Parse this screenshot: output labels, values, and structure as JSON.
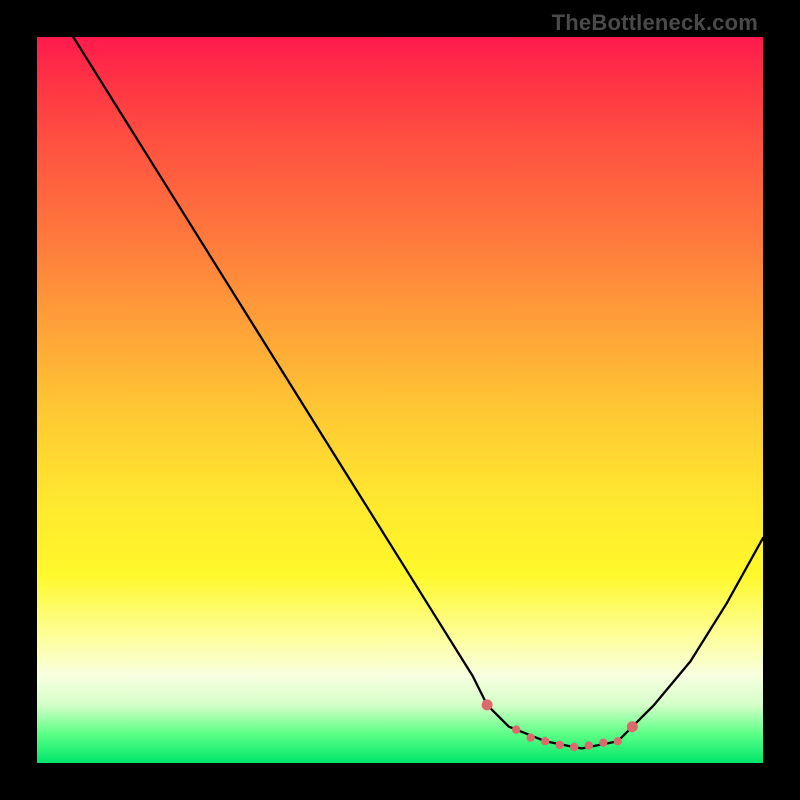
{
  "watermark": "TheBottleneck.com",
  "chart_data": {
    "type": "line",
    "title": "",
    "xlabel": "",
    "ylabel": "",
    "xlim": [
      0,
      100
    ],
    "ylim": [
      0,
      100
    ],
    "series": [
      {
        "name": "bottleneck-curve",
        "x": [
          5,
          10,
          15,
          20,
          25,
          30,
          35,
          40,
          45,
          50,
          55,
          60,
          62,
          65,
          70,
          75,
          80,
          82,
          85,
          90,
          95,
          100
        ],
        "values": [
          100,
          92,
          84,
          76,
          68,
          60,
          52,
          44,
          36,
          28,
          20,
          12,
          8,
          5,
          3,
          2,
          3,
          5,
          8,
          14,
          22,
          31
        ]
      }
    ],
    "markers": {
      "name": "highlight-dots",
      "x": [
        62,
        66,
        68,
        70,
        72,
        74,
        76,
        78,
        80,
        82
      ],
      "values": [
        8,
        4.6,
        3.5,
        3.0,
        2.5,
        2.2,
        2.4,
        2.8,
        3.0,
        5.0
      ],
      "color": "#dd6a6a"
    },
    "gradient_stops": [
      {
        "pos": 0,
        "color": "#ff1a4d"
      },
      {
        "pos": 16,
        "color": "#ff5540"
      },
      {
        "pos": 40,
        "color": "#ffa238"
      },
      {
        "pos": 64,
        "color": "#ffe82f"
      },
      {
        "pos": 88,
        "color": "#f8ffe0"
      },
      {
        "pos": 100,
        "color": "#00e66a"
      }
    ]
  }
}
